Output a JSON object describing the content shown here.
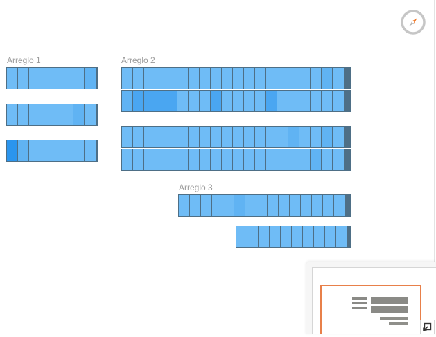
{
  "icons": {
    "compass": "compass-icon",
    "collapse": "collapse-minimap-icon"
  },
  "colors": {
    "cell_light": "#6fbcf6",
    "cell_mid": "#60b3f3",
    "cell_strong": "#4aa6f1",
    "cell_highlight": "#2b95ee",
    "cell_border": "#4e6f86",
    "label": "#9a9a9a",
    "viewport_frame": "#e8804a",
    "compass_ring": "#c6c6c6",
    "compass_needle": "#f07b2c"
  },
  "arrays": [
    {
      "label": "Arreglo 1",
      "rows": [
        {
          "cells": [
            0,
            0,
            0,
            0,
            0,
            0,
            0,
            1
          ]
        },
        {
          "cells": [
            0,
            0,
            0,
            0,
            0,
            0,
            1,
            0
          ]
        },
        {
          "cells": [
            3,
            1,
            0,
            0,
            0,
            0,
            0,
            0
          ]
        }
      ]
    },
    {
      "label": "Arreglo 2",
      "rows": [
        {
          "cells": [
            0,
            0,
            0,
            0,
            0,
            0,
            0,
            0,
            0,
            0,
            0,
            0,
            0,
            0,
            0,
            0,
            0,
            0,
            1,
            0
          ]
        },
        {
          "cells": [
            1,
            2,
            2,
            2,
            2,
            0,
            0,
            0,
            2,
            0,
            0,
            0,
            0,
            2,
            0,
            0,
            0,
            0,
            0,
            0
          ]
        },
        {
          "cells": [
            0,
            0,
            0,
            0,
            0,
            0,
            0,
            0,
            0,
            0,
            0,
            0,
            0,
            0,
            0,
            1,
            0,
            0,
            1,
            0
          ]
        },
        {
          "cells": [
            0,
            0,
            0,
            0,
            0,
            0,
            0,
            0,
            0,
            0,
            0,
            0,
            0,
            0,
            0,
            0,
            0,
            1,
            0,
            0
          ]
        }
      ]
    },
    {
      "label": "Arreglo 3",
      "rows": [
        {
          "cells": [
            0,
            0,
            0,
            0,
            0,
            1,
            0,
            0,
            0,
            0,
            0,
            0,
            0,
            0,
            0
          ]
        },
        {
          "cells": [
            0,
            0,
            0,
            0,
            0,
            0,
            0,
            0,
            0,
            0
          ]
        }
      ]
    }
  ]
}
